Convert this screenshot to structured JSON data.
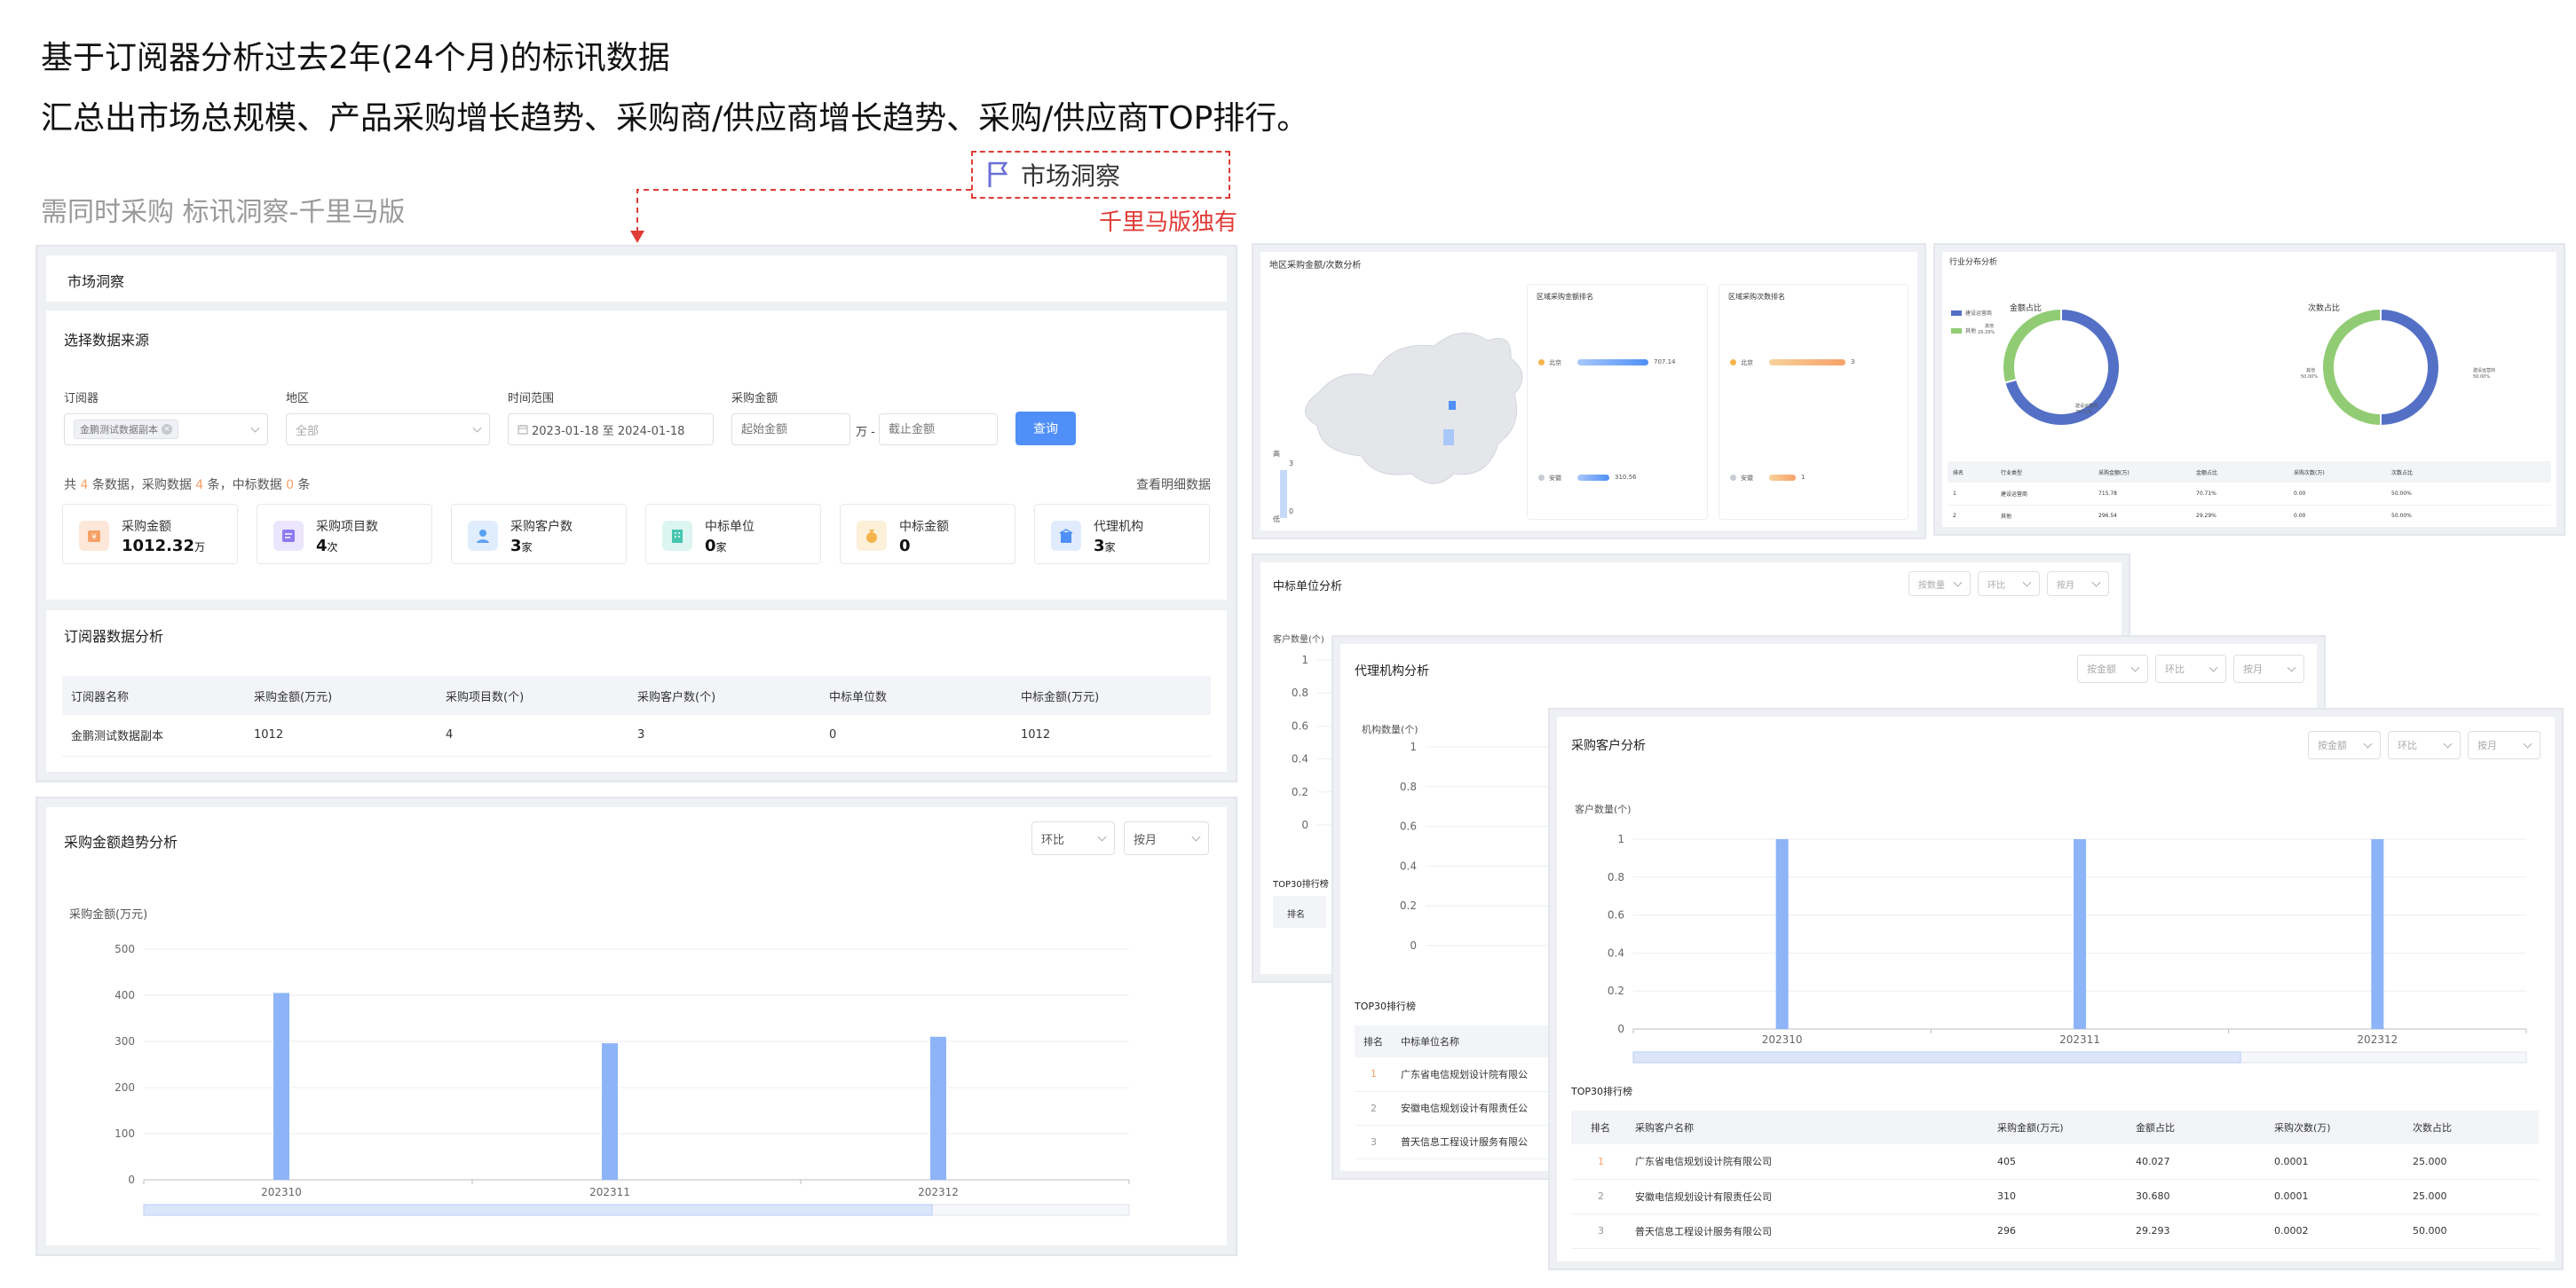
{
  "intro": {
    "line1": "基于订阅器分析过去2年(24个月)的标讯数据",
    "line2": "汇总出市场总规模、产品采购增长趋势、采购商/供应商增长趋势、采购/供应商TOP排行。",
    "note": "需同时采购 标讯洞察-千里马版",
    "flag_label": "市场洞察",
    "exclusive": "千里马版独有"
  },
  "main": {
    "header": "市场洞察",
    "source_title": "选择数据来源",
    "filters": {
      "subscriber_label": "订阅器",
      "subscriber_tag": "金鹏测试数据副本",
      "region_label": "地区",
      "region_value": "全部",
      "time_label": "时间范围",
      "time_value": "2023-01-18 至 2024-01-18",
      "amount_label": "采购金额",
      "amount_min_placeholder": "起始金额",
      "amount_unit": "万 -",
      "amount_max_placeholder": "截止金额",
      "query_button": "查询"
    },
    "summary": {
      "p1": "共 ",
      "n1": "4",
      "p2": " 条数据，采购数据 ",
      "n2": "4",
      "p3": " 条，中标数据 ",
      "n3": "0",
      "p4": " 条",
      "detail_link": "查看明细数据"
    },
    "stats": [
      {
        "label": "采购金额",
        "value": "1012.32",
        "unit": "万",
        "icon": "money-bag-icon",
        "color": "#f6a167"
      },
      {
        "label": "采购项目数",
        "value": "4",
        "unit": "次",
        "icon": "project-icon",
        "color": "#8c7cf0"
      },
      {
        "label": "采购客户数",
        "value": "3",
        "unit": "家",
        "icon": "user-icon",
        "color": "#5aa0f5"
      },
      {
        "label": "中标单位",
        "value": "0",
        "unit": "家",
        "icon": "building-icon",
        "color": "#46c6b0"
      },
      {
        "label": "中标金额",
        "value": "0",
        "unit": "",
        "icon": "coin-bag-icon",
        "color": "#f5b44c"
      },
      {
        "label": "代理机构",
        "value": "3",
        "unit": "家",
        "icon": "agency-icon",
        "color": "#4f8ff7"
      }
    ],
    "sub_table": {
      "title": "订阅器数据分析",
      "headers": [
        "订阅器名称",
        "采购金额(万元)",
        "采购项目数(个)",
        "采购客户数(个)",
        "中标单位数",
        "中标金额(万元)"
      ],
      "rows": [
        [
          "金鹏测试数据副本",
          "1012",
          "4",
          "3",
          "0",
          "1012"
        ]
      ]
    }
  },
  "trend": {
    "title": "采购金额趋势分析",
    "select1": "环比",
    "select2": "按月",
    "ylabel": "采购金额(万元)"
  },
  "region": {
    "title": "地区采购金额/次数分析",
    "amount_rank_title": "区域采购金额排名",
    "count_rank_title": "区域采购次数排名",
    "amount_rows": [
      {
        "name": "北京",
        "value": "707.14"
      },
      {
        "name": "安徽",
        "value": "310.56"
      }
    ],
    "count_rows": [
      {
        "name": "北京",
        "value": "3"
      },
      {
        "name": "安徽",
        "value": "1"
      }
    ],
    "legend_high": "高",
    "legend_low": "低",
    "legend_v1": "3",
    "legend_v2": "0"
  },
  "industry": {
    "title": "行业分布分析",
    "legend": [
      "建设运营商",
      "其他"
    ],
    "donut1_title": "金额占比",
    "donut2_title": "次数占比",
    "donut_labels": {
      "a": "建设运营商",
      "a_pct": "70.71%",
      "b": "其他",
      "b_pct": "29.29%",
      "c": "其他",
      "c_pct": "50.00%",
      "d": "建设运营商",
      "d_pct": "50.00%"
    },
    "headers": [
      "排名",
      "行业类型",
      "采购金额(万)",
      "金额占比",
      "采购次数(万)",
      "次数占比"
    ],
    "rows": [
      [
        "1",
        "建设运营商",
        "715.78",
        "70.71%",
        "0.00",
        "50.00%"
      ],
      [
        "2",
        "其他",
        "296.54",
        "29.29%",
        "0.00",
        "50.00%"
      ]
    ]
  },
  "winner": {
    "title": "中标单位分析",
    "select1": "按数量",
    "select2": "环比",
    "select3": "按月",
    "ylabel": "客户数量(个)",
    "top_title": "TOP30排行榜",
    "rank_header": "排名"
  },
  "agency": {
    "title": "代理机构分析",
    "select1": "按金额",
    "select2": "环比",
    "select3": "按月",
    "ylabel": "机构数量(个)",
    "top_title": "TOP30排行榜",
    "headers": [
      "排名",
      "中标单位名称"
    ],
    "rows": [
      [
        "1",
        "广东省电信规划设计院有限公"
      ],
      [
        "2",
        "安徽电信规划设计有限责任公"
      ],
      [
        "3",
        "普天信息工程设计服务有限公"
      ]
    ]
  },
  "customer": {
    "title": "采购客户分析",
    "select1": "按金额",
    "select2": "环比",
    "select3": "按月",
    "ylabel": "客户数量(个)",
    "top_title": "TOP30排行榜",
    "headers": [
      "排名",
      "采购客户名称",
      "采购金额(万元)",
      "金额占比",
      "采购次数(万)",
      "次数占比"
    ],
    "rows": [
      [
        "1",
        "广东省电信规划设计院有限公司",
        "405",
        "40.027",
        "0.0001",
        "25.000"
      ],
      [
        "2",
        "安徽电信规划设计有限责任公司",
        "310",
        "30.680",
        "0.0001",
        "25.000"
      ],
      [
        "3",
        "普天信息工程设计服务有限公司",
        "296",
        "29.293",
        "0.0002",
        "50.000"
      ]
    ]
  },
  "colors": {
    "accent": "#4f8ff7",
    "bar": "#8db4f7",
    "donut_blue": "#5470c6",
    "donut_green": "#91cc75",
    "orange": "#f6a167",
    "red": "#e03b35"
  },
  "chart_data": [
    {
      "type": "bar",
      "name": "采购金额趋势分析",
      "categories": [
        "202310",
        "202311",
        "202312"
      ],
      "values": [
        405,
        296,
        310
      ],
      "ylim": [
        0,
        500
      ],
      "yticks": [
        0,
        100,
        200,
        300,
        400,
        500
      ],
      "ylabel": "采购金额(万元)",
      "grid": true
    },
    {
      "type": "bar",
      "name": "采购客户分析",
      "categories": [
        "202310",
        "202311",
        "202312"
      ],
      "values": [
        1,
        1,
        1
      ],
      "ylim": [
        0,
        1
      ],
      "yticks": [
        0,
        0.2,
        0.4,
        0.6,
        0.8,
        1
      ],
      "ylabel": "客户数量(个)",
      "grid": true
    },
    {
      "type": "bar",
      "name": "代理机构分析",
      "categories": [],
      "values": [],
      "ylim": [
        0,
        1
      ],
      "yticks": [
        0,
        0.2,
        0.4,
        0.6,
        0.8,
        1
      ],
      "ylabel": "机构数量(个)"
    },
    {
      "type": "bar",
      "name": "中标单位分析",
      "categories": [],
      "values": [],
      "ylim": [
        0,
        1
      ],
      "yticks": [
        0,
        0.2,
        0.4,
        0.6,
        0.8,
        1
      ],
      "ylabel": "客户数量(个)"
    },
    {
      "type": "pie",
      "name": "金额占比",
      "labels": [
        "建设运营商",
        "其他"
      ],
      "values": [
        70.71,
        29.29
      ]
    },
    {
      "type": "pie",
      "name": "次数占比",
      "labels": [
        "建设运营商",
        "其他"
      ],
      "values": [
        50.0,
        50.0
      ]
    }
  ]
}
